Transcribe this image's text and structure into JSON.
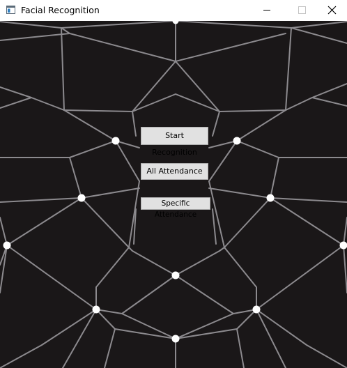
{
  "window": {
    "title": "Facial Recognition",
    "background_color": "#1a1718",
    "mesh_color": "#8c8a8e",
    "landmark_color": "#ffffff",
    "icons": [
      "app-icon",
      "minimize-icon",
      "maximize-icon",
      "close-icon"
    ]
  },
  "buttons": {
    "start_recognition": "Start Recognition",
    "all_attendance": "All Attendance",
    "specific_attendance": "Specific Attendance"
  }
}
